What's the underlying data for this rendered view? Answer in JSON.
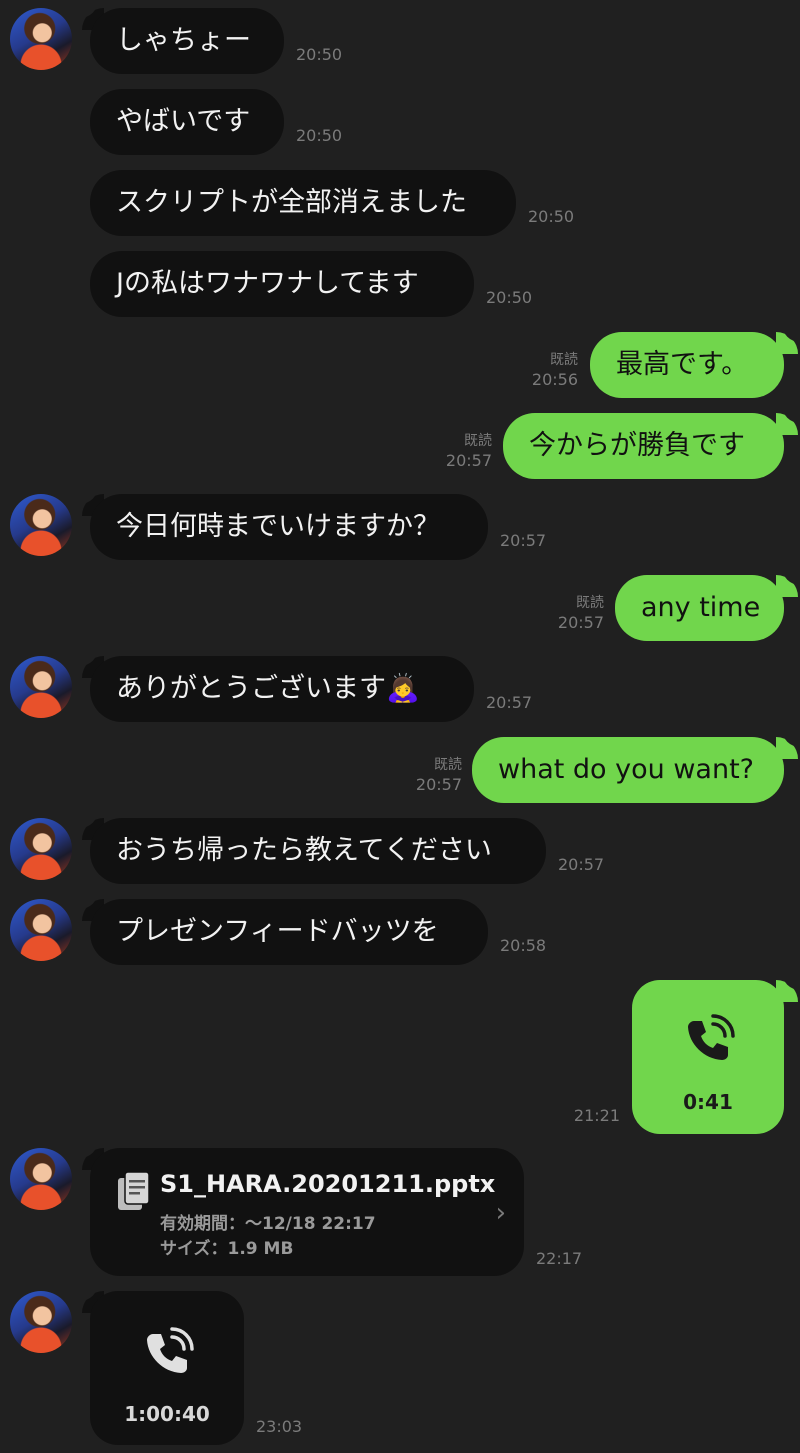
{
  "messages": [
    {
      "text": "しゃちょー",
      "time": "20:50"
    },
    {
      "text": "やばいです",
      "time": "20:50"
    },
    {
      "text": "スクリプトが全部消えました",
      "time": "20:50"
    },
    {
      "text": "Jの私はワナワナしてます",
      "time": "20:50"
    },
    {
      "text": "最高です。",
      "time": "20:56",
      "read": "既読"
    },
    {
      "text": "今からが勝負です",
      "time": "20:57",
      "read": "既読"
    },
    {
      "text": "今日何時までいけますか？",
      "time": "20:57"
    },
    {
      "text": "any time",
      "time": "20:57",
      "read": "既読"
    },
    {
      "text": "ありがとうございます🙇‍♀️",
      "time": "20:57"
    },
    {
      "text": "what do you want?",
      "time": "20:57",
      "read": "既読"
    },
    {
      "text": "おうち帰ったら教えてください",
      "time": "20:57"
    },
    {
      "text": "プレゼンフィードバッツを",
      "time": "20:58"
    }
  ],
  "call_out": {
    "duration": "0:41",
    "time": "21:21",
    "icon": "phone-call-icon"
  },
  "file": {
    "name": "S1_HARA.20201211.pptx",
    "expiry": "有効期間：～12/18 22:17",
    "size": "サイズ：1.9 MB",
    "time": "22:17",
    "icon": "document-icon"
  },
  "call_in": {
    "duration": "1:00:40",
    "time": "23:03",
    "icon": "phone-call-icon"
  },
  "colors": {
    "background": "#202020",
    "incoming": "#111111",
    "outgoing": "#71d64c",
    "meta": "#7b7b7b"
  }
}
